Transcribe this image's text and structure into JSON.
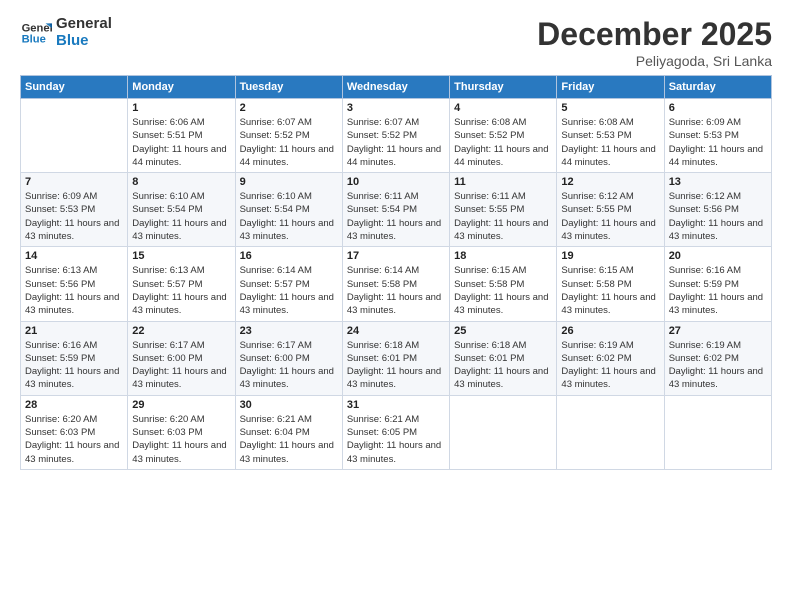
{
  "logo": {
    "line1": "General",
    "line2": "Blue"
  },
  "title": "December 2025",
  "subtitle": "Peliyagoda, Sri Lanka",
  "days_of_week": [
    "Sunday",
    "Monday",
    "Tuesday",
    "Wednesday",
    "Thursday",
    "Friday",
    "Saturday"
  ],
  "weeks": [
    [
      {
        "day": "",
        "sunrise": "",
        "sunset": "",
        "daylight": ""
      },
      {
        "day": "1",
        "sunrise": "6:06 AM",
        "sunset": "5:51 PM",
        "daylight": "11 hours and 44 minutes."
      },
      {
        "day": "2",
        "sunrise": "6:07 AM",
        "sunset": "5:52 PM",
        "daylight": "11 hours and 44 minutes."
      },
      {
        "day": "3",
        "sunrise": "6:07 AM",
        "sunset": "5:52 PM",
        "daylight": "11 hours and 44 minutes."
      },
      {
        "day": "4",
        "sunrise": "6:08 AM",
        "sunset": "5:52 PM",
        "daylight": "11 hours and 44 minutes."
      },
      {
        "day": "5",
        "sunrise": "6:08 AM",
        "sunset": "5:53 PM",
        "daylight": "11 hours and 44 minutes."
      },
      {
        "day": "6",
        "sunrise": "6:09 AM",
        "sunset": "5:53 PM",
        "daylight": "11 hours and 44 minutes."
      }
    ],
    [
      {
        "day": "7",
        "sunrise": "6:09 AM",
        "sunset": "5:53 PM",
        "daylight": "11 hours and 43 minutes."
      },
      {
        "day": "8",
        "sunrise": "6:10 AM",
        "sunset": "5:54 PM",
        "daylight": "11 hours and 43 minutes."
      },
      {
        "day": "9",
        "sunrise": "6:10 AM",
        "sunset": "5:54 PM",
        "daylight": "11 hours and 43 minutes."
      },
      {
        "day": "10",
        "sunrise": "6:11 AM",
        "sunset": "5:54 PM",
        "daylight": "11 hours and 43 minutes."
      },
      {
        "day": "11",
        "sunrise": "6:11 AM",
        "sunset": "5:55 PM",
        "daylight": "11 hours and 43 minutes."
      },
      {
        "day": "12",
        "sunrise": "6:12 AM",
        "sunset": "5:55 PM",
        "daylight": "11 hours and 43 minutes."
      },
      {
        "day": "13",
        "sunrise": "6:12 AM",
        "sunset": "5:56 PM",
        "daylight": "11 hours and 43 minutes."
      }
    ],
    [
      {
        "day": "14",
        "sunrise": "6:13 AM",
        "sunset": "5:56 PM",
        "daylight": "11 hours and 43 minutes."
      },
      {
        "day": "15",
        "sunrise": "6:13 AM",
        "sunset": "5:57 PM",
        "daylight": "11 hours and 43 minutes."
      },
      {
        "day": "16",
        "sunrise": "6:14 AM",
        "sunset": "5:57 PM",
        "daylight": "11 hours and 43 minutes."
      },
      {
        "day": "17",
        "sunrise": "6:14 AM",
        "sunset": "5:58 PM",
        "daylight": "11 hours and 43 minutes."
      },
      {
        "day": "18",
        "sunrise": "6:15 AM",
        "sunset": "5:58 PM",
        "daylight": "11 hours and 43 minutes."
      },
      {
        "day": "19",
        "sunrise": "6:15 AM",
        "sunset": "5:58 PM",
        "daylight": "11 hours and 43 minutes."
      },
      {
        "day": "20",
        "sunrise": "6:16 AM",
        "sunset": "5:59 PM",
        "daylight": "11 hours and 43 minutes."
      }
    ],
    [
      {
        "day": "21",
        "sunrise": "6:16 AM",
        "sunset": "5:59 PM",
        "daylight": "11 hours and 43 minutes."
      },
      {
        "day": "22",
        "sunrise": "6:17 AM",
        "sunset": "6:00 PM",
        "daylight": "11 hours and 43 minutes."
      },
      {
        "day": "23",
        "sunrise": "6:17 AM",
        "sunset": "6:00 PM",
        "daylight": "11 hours and 43 minutes."
      },
      {
        "day": "24",
        "sunrise": "6:18 AM",
        "sunset": "6:01 PM",
        "daylight": "11 hours and 43 minutes."
      },
      {
        "day": "25",
        "sunrise": "6:18 AM",
        "sunset": "6:01 PM",
        "daylight": "11 hours and 43 minutes."
      },
      {
        "day": "26",
        "sunrise": "6:19 AM",
        "sunset": "6:02 PM",
        "daylight": "11 hours and 43 minutes."
      },
      {
        "day": "27",
        "sunrise": "6:19 AM",
        "sunset": "6:02 PM",
        "daylight": "11 hours and 43 minutes."
      }
    ],
    [
      {
        "day": "28",
        "sunrise": "6:20 AM",
        "sunset": "6:03 PM",
        "daylight": "11 hours and 43 minutes."
      },
      {
        "day": "29",
        "sunrise": "6:20 AM",
        "sunset": "6:03 PM",
        "daylight": "11 hours and 43 minutes."
      },
      {
        "day": "30",
        "sunrise": "6:21 AM",
        "sunset": "6:04 PM",
        "daylight": "11 hours and 43 minutes."
      },
      {
        "day": "31",
        "sunrise": "6:21 AM",
        "sunset": "6:05 PM",
        "daylight": "11 hours and 43 minutes."
      },
      {
        "day": "",
        "sunrise": "",
        "sunset": "",
        "daylight": ""
      },
      {
        "day": "",
        "sunrise": "",
        "sunset": "",
        "daylight": ""
      },
      {
        "day": "",
        "sunrise": "",
        "sunset": "",
        "daylight": ""
      }
    ]
  ]
}
